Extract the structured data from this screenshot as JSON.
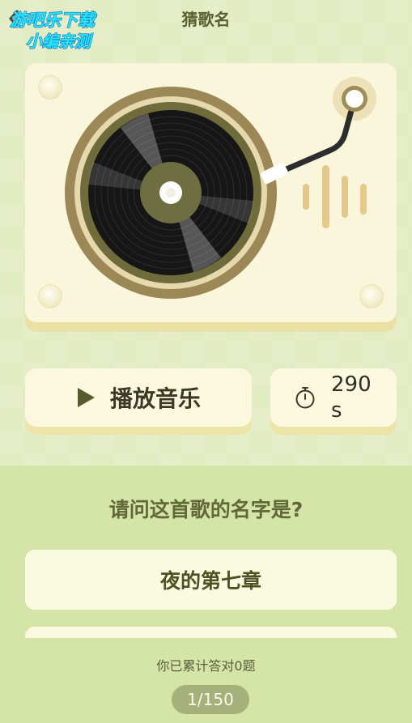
{
  "header": {
    "title": "猜歌名",
    "watermark_line1": "游吧乐下载",
    "watermark_line2": "小编亲测"
  },
  "icons": {
    "back": "chevron-left-icon",
    "play": "play-icon",
    "timer": "stopwatch-icon"
  },
  "controls": {
    "play_label": "播放音乐",
    "timer_text": "290 s"
  },
  "quiz": {
    "question": "请问这首歌的名字是?",
    "options": [
      "夜的第七章"
    ],
    "correct_text": "你已累计答对0题",
    "progress": "1/150"
  },
  "colors": {
    "background": "#e3edc4",
    "panel": "#d5e4a7",
    "card": "#faf6dc",
    "accent_brown": "#9b8553",
    "progress_pill": "#a6b07b"
  }
}
